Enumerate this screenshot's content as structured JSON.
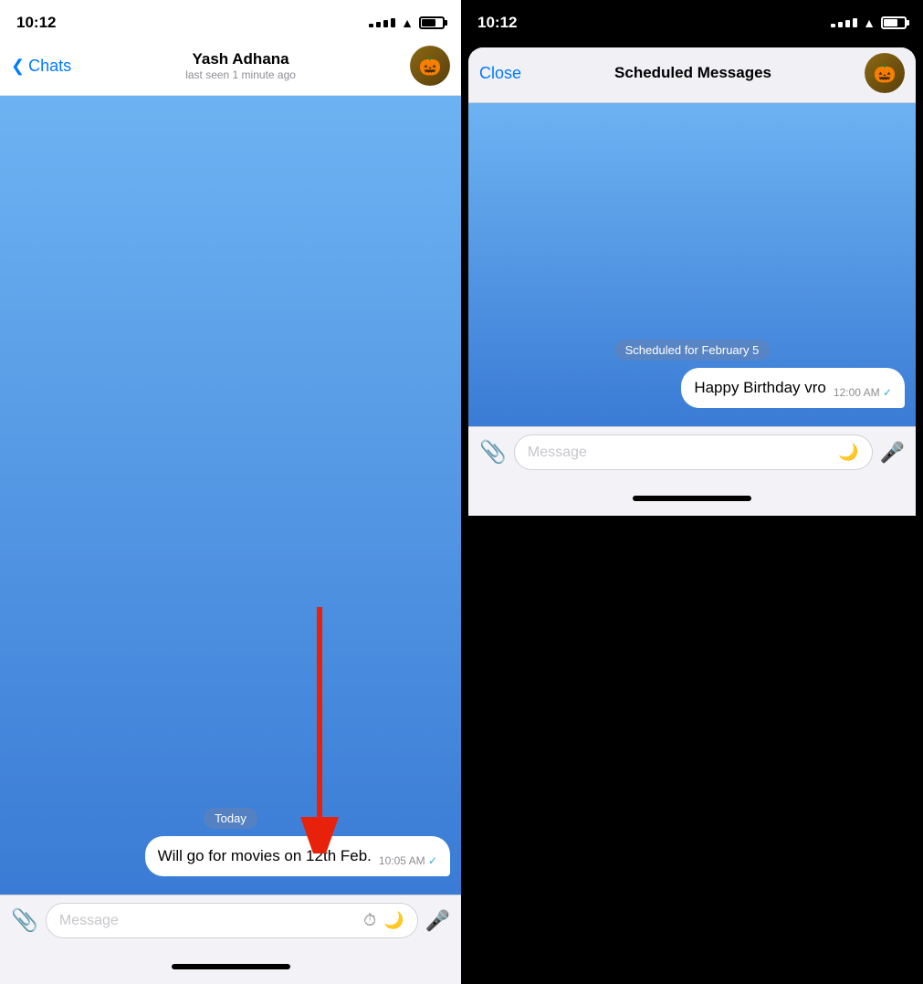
{
  "left": {
    "status": {
      "time": "10:12"
    },
    "nav": {
      "back_label": "Chats",
      "title": "Yash Adhana",
      "subtitle": "last seen 1 minute ago"
    },
    "messages": [
      {
        "type": "date",
        "text": "Today"
      },
      {
        "type": "outgoing",
        "text": "Will go for movies on 12th Feb.",
        "time": "10:05 AM",
        "delivered": true
      }
    ],
    "input": {
      "placeholder": "Message"
    }
  },
  "right": {
    "status": {
      "time": "10:12"
    },
    "nav": {
      "close_label": "Close",
      "title": "Scheduled Messages"
    },
    "messages": [
      {
        "type": "date",
        "text": "Scheduled for February 5"
      },
      {
        "type": "outgoing",
        "text": "Happy Birthday vro",
        "time": "12:00 AM",
        "delivered": true
      }
    ],
    "input": {
      "placeholder": "Message"
    }
  }
}
